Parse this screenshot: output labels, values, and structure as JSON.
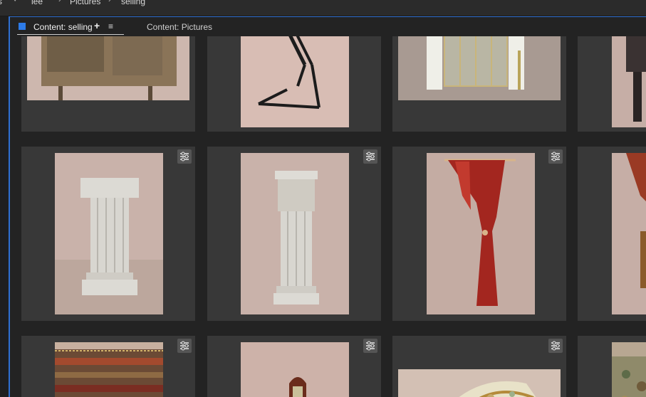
{
  "breadcrumb": {
    "items": [
      "s",
      "lee",
      "Pictures",
      "selling"
    ]
  },
  "tabs": {
    "active": {
      "label": "Content: selling",
      "add_symbol": "+",
      "menu_symbol": "≡"
    },
    "inactive": {
      "label": "Content: Pictures"
    }
  },
  "icons": {
    "tab_square": "panel-square-icon",
    "settings": "sliders-icon",
    "chevron": "chevron-right-icon"
  },
  "colors": {
    "accent": "#2d7be8",
    "card_bg": "#383838",
    "panel_bg": "#232323"
  },
  "thumbnails": [
    {
      "subject": "stone-chair"
    },
    {
      "subject": "black-metal-stand"
    },
    {
      "subject": "fireplace-with-screen"
    },
    {
      "subject": "dark-item-partial"
    },
    {
      "subject": "corinthian-column-short"
    },
    {
      "subject": "corinthian-column-tall"
    },
    {
      "subject": "red-curtain-drape"
    },
    {
      "subject": "fringed-drape-partial"
    },
    {
      "subject": "tapestry-fabric"
    },
    {
      "subject": "upholstered-chair"
    },
    {
      "subject": "floral-chair-close"
    },
    {
      "subject": "woven-fabric-partial"
    }
  ]
}
